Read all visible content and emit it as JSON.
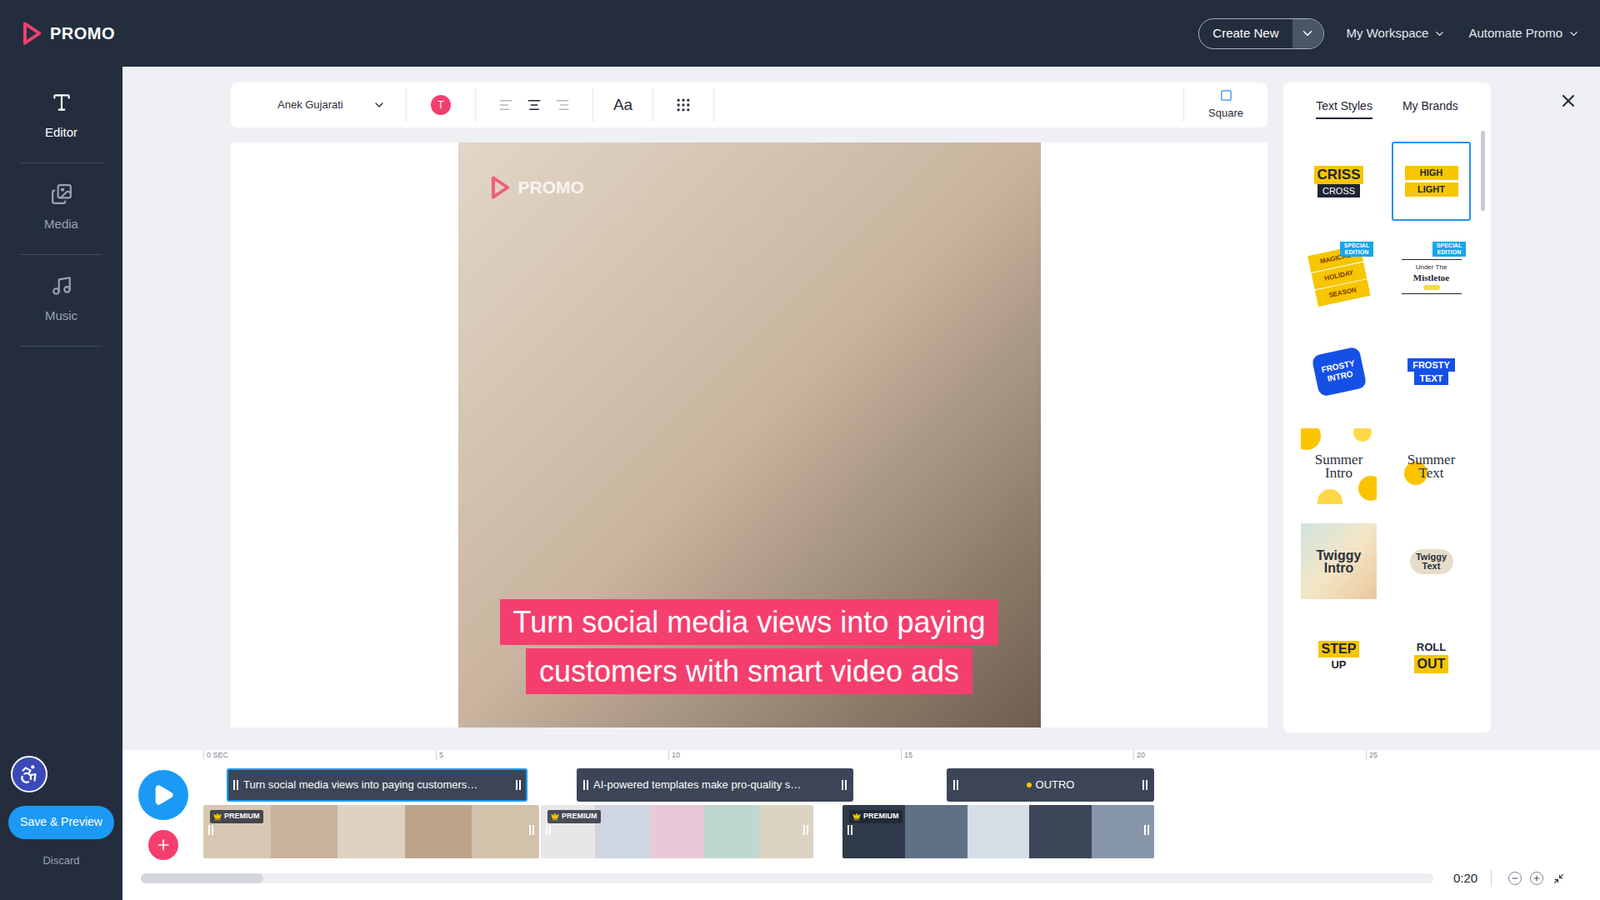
{
  "topbar": {
    "logo": "PROMO",
    "create_button": "Create New",
    "menus": [
      "My Workspace",
      "Automate Promo"
    ]
  },
  "sidebar": {
    "items": [
      {
        "label": "Editor",
        "selected": true
      },
      {
        "label": "Media",
        "selected": false
      },
      {
        "label": "Music",
        "selected": false
      }
    ],
    "save_button": "Save & Preview",
    "discard": "Discard"
  },
  "toolbar": {
    "font": "Anek Gujarati",
    "color_swatch": {
      "label": "T",
      "color": "#f43f6e"
    },
    "alignments": [
      {
        "kind": "left",
        "selected": false
      },
      {
        "kind": "center",
        "selected": true
      },
      {
        "kind": "right",
        "selected": false
      }
    ],
    "text_size": "Aa",
    "format": "Square"
  },
  "canvas": {
    "watermark": "PROMO",
    "caption": [
      "Turn social media views into paying",
      "customers with smart video ads"
    ]
  },
  "style_panel": {
    "tabs": [
      {
        "label": "Text Styles",
        "selected": true
      },
      {
        "label": "My Brands",
        "selected": false
      }
    ],
    "styles": [
      {
        "kind": "criss-cross",
        "lines": [
          "CRISS",
          "CROSS"
        ],
        "badge": "",
        "selected": false
      },
      {
        "kind": "highlight",
        "lines": [
          "HIGH",
          "LIGHT"
        ],
        "badge": "",
        "selected": true
      },
      {
        "kind": "holiday",
        "lines": [
          "MAGICAL",
          "HOLIDAY",
          "SEASON"
        ],
        "badge": "SPECIAL EDITION",
        "selected": false
      },
      {
        "kind": "mistletoe",
        "lines": [
          "Under The",
          "Mistletoe"
        ],
        "badge": "SPECIAL EDITION",
        "selected": false
      },
      {
        "kind": "frosty-intro",
        "lines": [
          "FROSTY",
          "INTRO"
        ],
        "badge": "",
        "selected": false
      },
      {
        "kind": "frosty-text",
        "lines": [
          "FROSTY",
          "TEXT"
        ],
        "badge": "",
        "selected": false
      },
      {
        "kind": "summer-intro",
        "lines": [
          "Summer",
          "Intro"
        ],
        "badge": "",
        "selected": false
      },
      {
        "kind": "summer-text",
        "lines": [
          "Summer",
          "Text"
        ],
        "badge": "",
        "selected": false
      },
      {
        "kind": "twiggy-intro",
        "lines": [
          "Twiggy",
          "Intro"
        ],
        "badge": "",
        "selected": false
      },
      {
        "kind": "twiggy-text",
        "lines": [
          "Twiggy",
          "Text"
        ],
        "badge": "",
        "selected": false
      },
      {
        "kind": "step-up",
        "lines": [
          "STEP",
          "UP"
        ],
        "badge": "",
        "selected": false
      },
      {
        "kind": "roll-out",
        "lines": [
          "ROLL",
          "OUT"
        ],
        "badge": "",
        "selected": false
      }
    ]
  },
  "timeline": {
    "ruler": [
      "0 SEC",
      "5",
      "10",
      "15",
      "20",
      "25"
    ],
    "text_clips": [
      {
        "kind": "text",
        "label": "Turn social media views into paying customers…",
        "selected": true
      },
      {
        "kind": "text",
        "label": "AI-powered templates make pro-quality s…",
        "selected": false
      },
      {
        "kind": "outro",
        "label": "OUTRO",
        "selected": false
      }
    ],
    "video_clips": [
      {
        "badge": "PREMIUM"
      },
      {
        "badge": "PREMIUM"
      },
      {
        "badge": "PREMIUM"
      }
    ],
    "duration": "0:20"
  }
}
